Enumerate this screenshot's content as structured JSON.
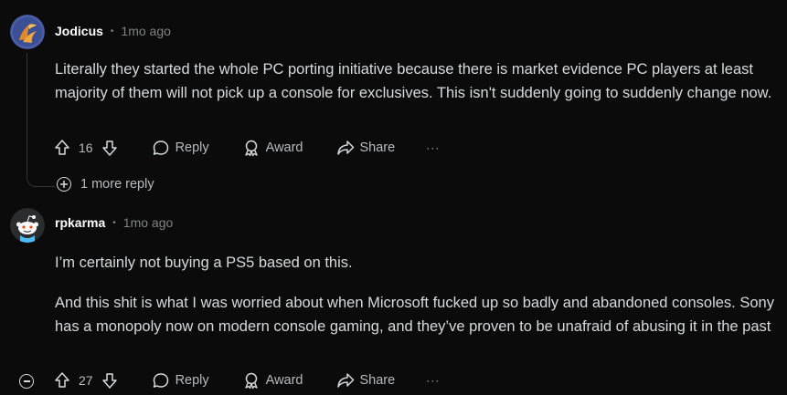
{
  "comments": [
    {
      "username": "Jodicus",
      "separator": "•",
      "time": "1mo ago",
      "body": [
        "Literally they started the whole PC porting initiative because there is market evidence PC players at least majority of them will not pick up a console for exclusives. This isn't suddenly going to suddenly change now."
      ],
      "score": "16",
      "reply_label": "Reply",
      "award_label": "Award",
      "share_label": "Share",
      "more_label": "···",
      "more_replies_label": "1 more reply"
    },
    {
      "username": "rpkarma",
      "separator": "•",
      "time": "1mo ago",
      "body": [
        "I’m certainly not buying a PS5 based on this.",
        "And this shit is what I was worried about when Microsoft fucked up so badly and abandoned consoles. Sony has a monopoly now on modern console gaming, and they’ve proven to be unafraid of abusing it in the past"
      ],
      "score": "27",
      "reply_label": "Reply",
      "award_label": "Award",
      "share_label": "Share",
      "more_label": "···"
    }
  ],
  "colors": {
    "background": "#0b0b0b",
    "text": "#d7dadc",
    "muted": "#818384",
    "thread_line": "#343536"
  }
}
